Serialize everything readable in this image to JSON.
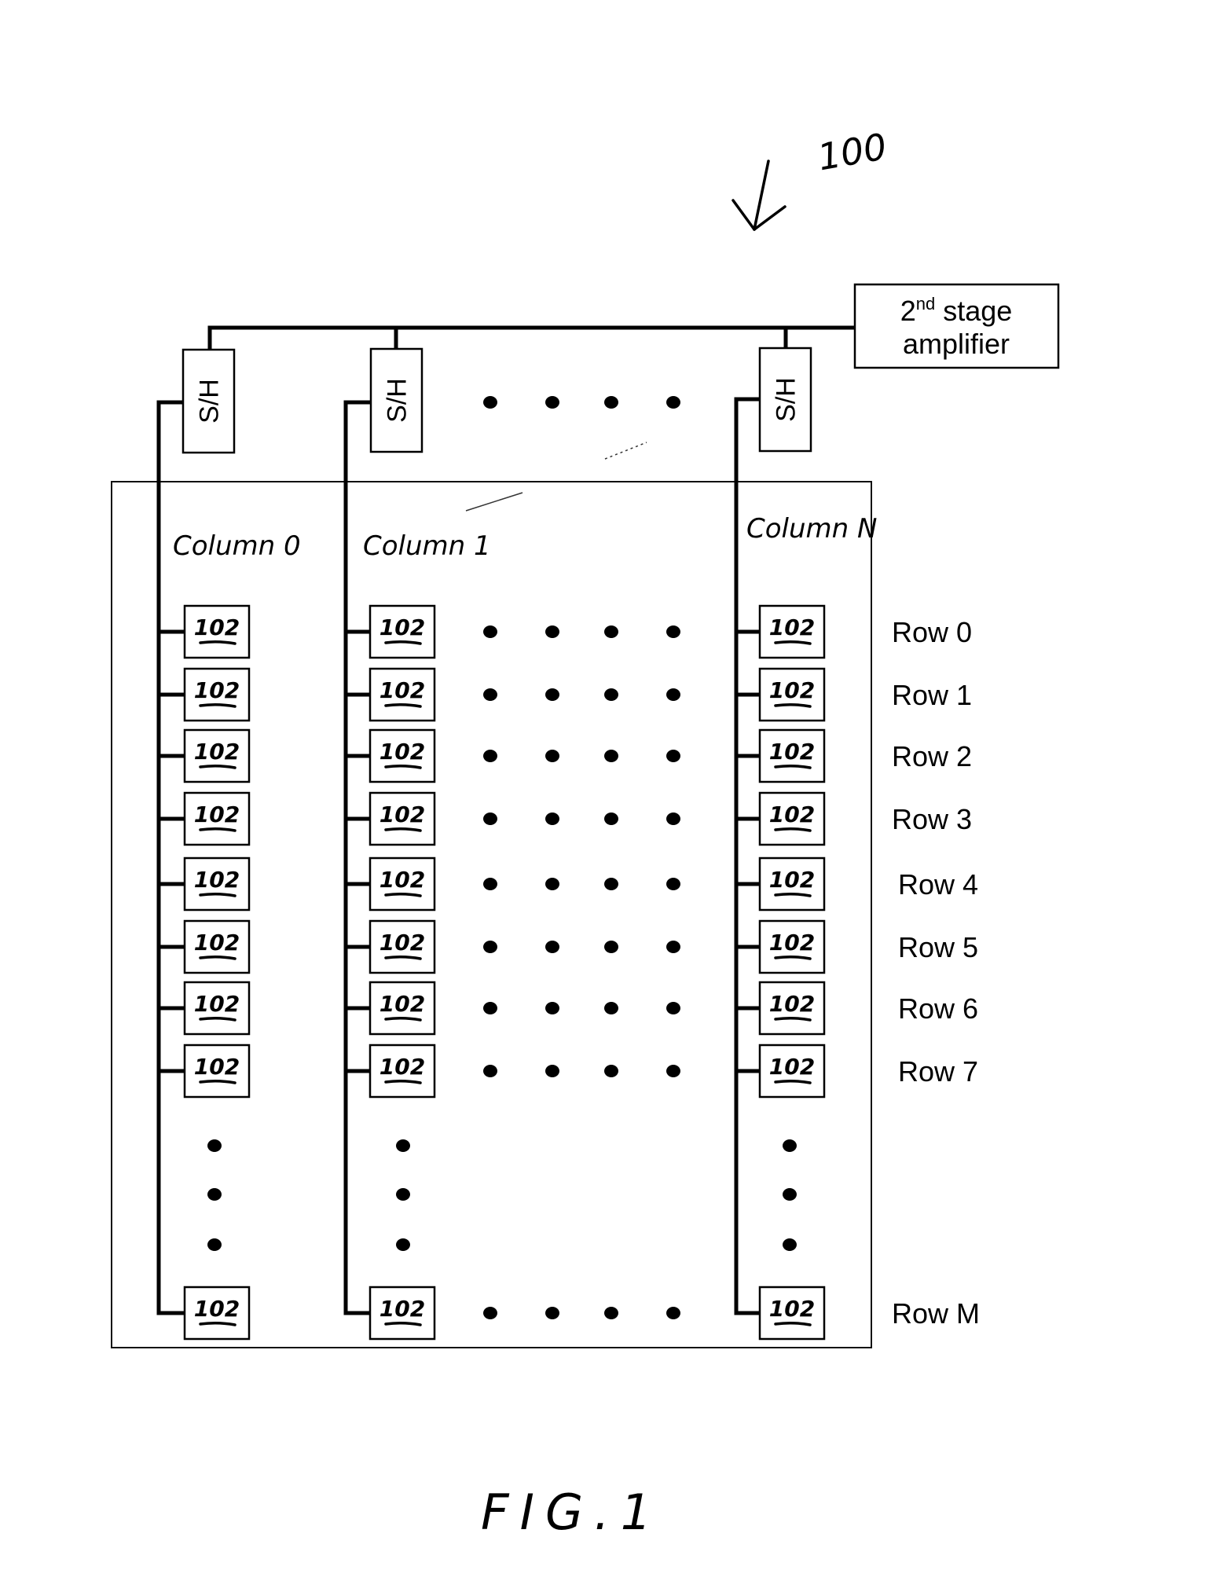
{
  "figure": {
    "reference_numeral": "100",
    "caption": "FIG.1"
  },
  "amplifier": {
    "label_main": "2",
    "label_sup": "nd",
    "label_rest": " stage",
    "label_line2": "amplifier"
  },
  "sample_hold": {
    "label": "S/H",
    "count_shown": 3
  },
  "columns": [
    {
      "label": "Column 0"
    },
    {
      "label": "Column 1"
    },
    {
      "label": "Column N"
    }
  ],
  "rows": [
    {
      "label": "Row 0"
    },
    {
      "label": "Row 1"
    },
    {
      "label": "Row 2"
    },
    {
      "label": "Row 3"
    },
    {
      "label": "Row 4"
    },
    {
      "label": "Row 5"
    },
    {
      "label": "Row 6"
    },
    {
      "label": "Row 7"
    },
    {
      "label": "Row M"
    }
  ],
  "cell": {
    "label": "102"
  },
  "ellipsis": {
    "horizontal_dots": 4,
    "vertical_dots": 3
  }
}
